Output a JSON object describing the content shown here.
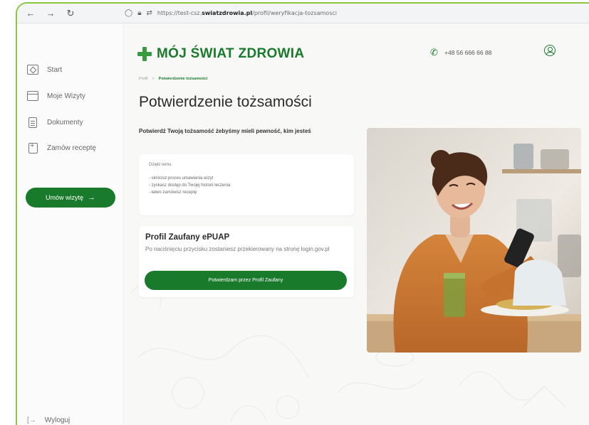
{
  "browser": {
    "url_prefix": "https://test-csz.",
    "url_domain": "swiatzdrowia.pl",
    "url_path": "/profil/weryfikacja-tozsamosci"
  },
  "sidebar": {
    "items": [
      {
        "label": "Start",
        "icon": "home-icon"
      },
      {
        "label": "Moje Wizyty",
        "icon": "calendar-icon"
      },
      {
        "label": "Dokumenty",
        "icon": "document-icon"
      },
      {
        "label": "Zamów receptę",
        "icon": "prescription-icon"
      }
    ],
    "cta_label": "Umów wizytę",
    "cta_arrow": "→",
    "logout_label": "Wyloguj",
    "logout_icon": "[→"
  },
  "header": {
    "logo_text": "MÓJ ŚWIAT ZDROWIA",
    "phone": "+48 56 666 66 88"
  },
  "breadcrumb": {
    "parent": "Profil",
    "separator": ">",
    "current": "Potwierdzenie tożsamości"
  },
  "page": {
    "title": "Potwierdzenie tożsamości",
    "lead": "Potwierdź Twoją tożsamość żebyśmy mieli pewność, kim jesteś"
  },
  "benefits": {
    "heading": "Dzięki temu:",
    "items": [
      "- skrócisz proces umawiania wizyt",
      "- zyskasz dostęp do Twojej historii leczenia",
      "- łatwo zamówisz receptę"
    ]
  },
  "epuap": {
    "title": "Profil Zaufany ePUAP",
    "description": "Po naciśnięciu przycisku zostaniesz przekierowany na stronę login.gov.pl",
    "button_label": "Potwierdzam przez Profil Zaufany"
  },
  "colors": {
    "brand_green": "#1a7a2c",
    "accent_green": "#3a9a42",
    "frame_green": "#8cc63f",
    "shirt_orange": "#c9772f"
  }
}
